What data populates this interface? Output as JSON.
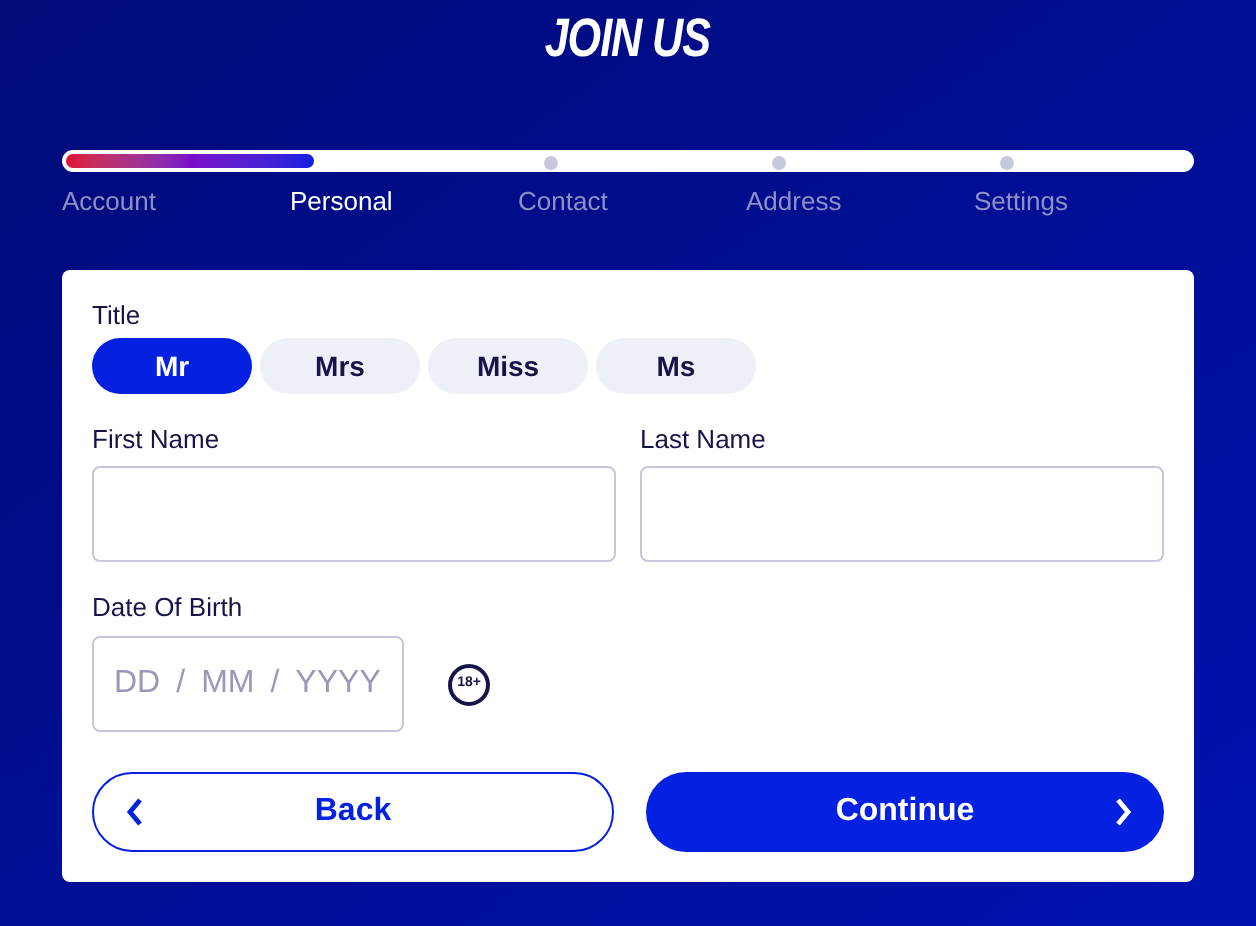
{
  "heading": "JOIN US",
  "progress": {
    "level": 0.222
  },
  "steps": [
    {
      "label": "Account",
      "selected": false
    },
    {
      "label": "Personal",
      "selected": true
    },
    {
      "label": "Contact",
      "selected": false
    },
    {
      "label": "Address",
      "selected": false
    },
    {
      "label": "Settings",
      "selected": false
    }
  ],
  "title_field": {
    "label": "Title",
    "options": [
      {
        "label": "Mr",
        "selected": true
      },
      {
        "label": "Mrs",
        "selected": false
      },
      {
        "label": "Miss",
        "selected": false
      },
      {
        "label": "Ms",
        "selected": false
      }
    ]
  },
  "first_name": {
    "label": "First Name"
  },
  "last_name": {
    "label": "Last Name"
  },
  "date_of_birth": {
    "label": "Date Of Birth",
    "day_placeholder": "DD",
    "separator_1": "/",
    "month_placeholder": "MM",
    "separator_2": "/",
    "year_placeholder": "YYYY",
    "age_badge": "18+"
  },
  "buttons": [
    {
      "kind": "back",
      "label": "Back"
    },
    {
      "kind": "continue",
      "label": "Continue"
    }
  ]
}
